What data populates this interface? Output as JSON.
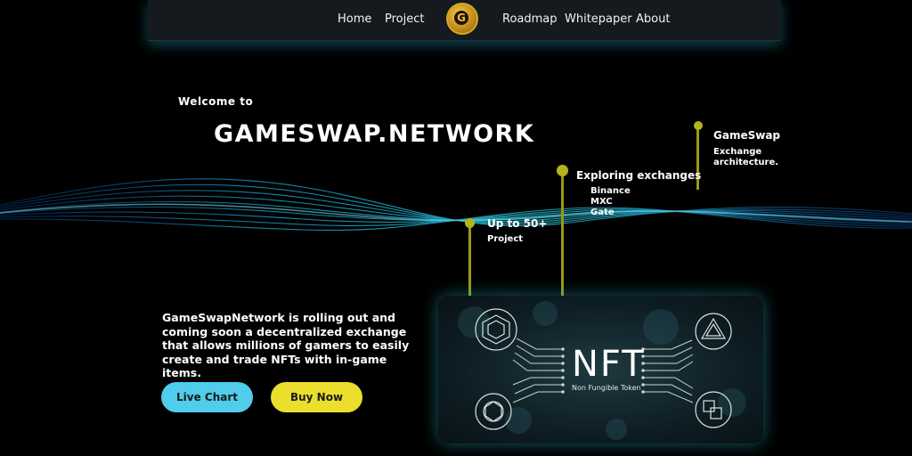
{
  "nav": {
    "links": [
      "Home",
      "Project",
      "Roadmap",
      "Whitepaper",
      "About"
    ],
    "logo_letter": "G"
  },
  "hero": {
    "welcome": "Welcome to",
    "title": "GAMESWAP.NETWORK"
  },
  "annotations": {
    "gameswap": {
      "title": "GameSwap",
      "lines": [
        "Exchange",
        "architecture."
      ]
    },
    "exploring": {
      "title": "Exploring exchanges",
      "lines": [
        "Binance",
        "MXC",
        "Gate"
      ]
    },
    "projects": {
      "title": "Up to 50+",
      "lines": [
        "Project"
      ]
    }
  },
  "description": "GameSwapNetwork is rolling out and coming soon a decentralized exchange that allows millions of gamers to easily create and trade NFTs with in-game items.",
  "buttons": {
    "live_chart": "Live Chart",
    "buy_now": "Buy Now"
  },
  "nft_card": {
    "title": "NFT",
    "subtitle": "Non Fungible Token"
  },
  "colors": {
    "background": "#000000",
    "accent_cyan": "#4fcdea",
    "accent_yellow": "#ecde2c",
    "pin_olive": "#9a9a14",
    "logo_gold": "#d9a528"
  }
}
